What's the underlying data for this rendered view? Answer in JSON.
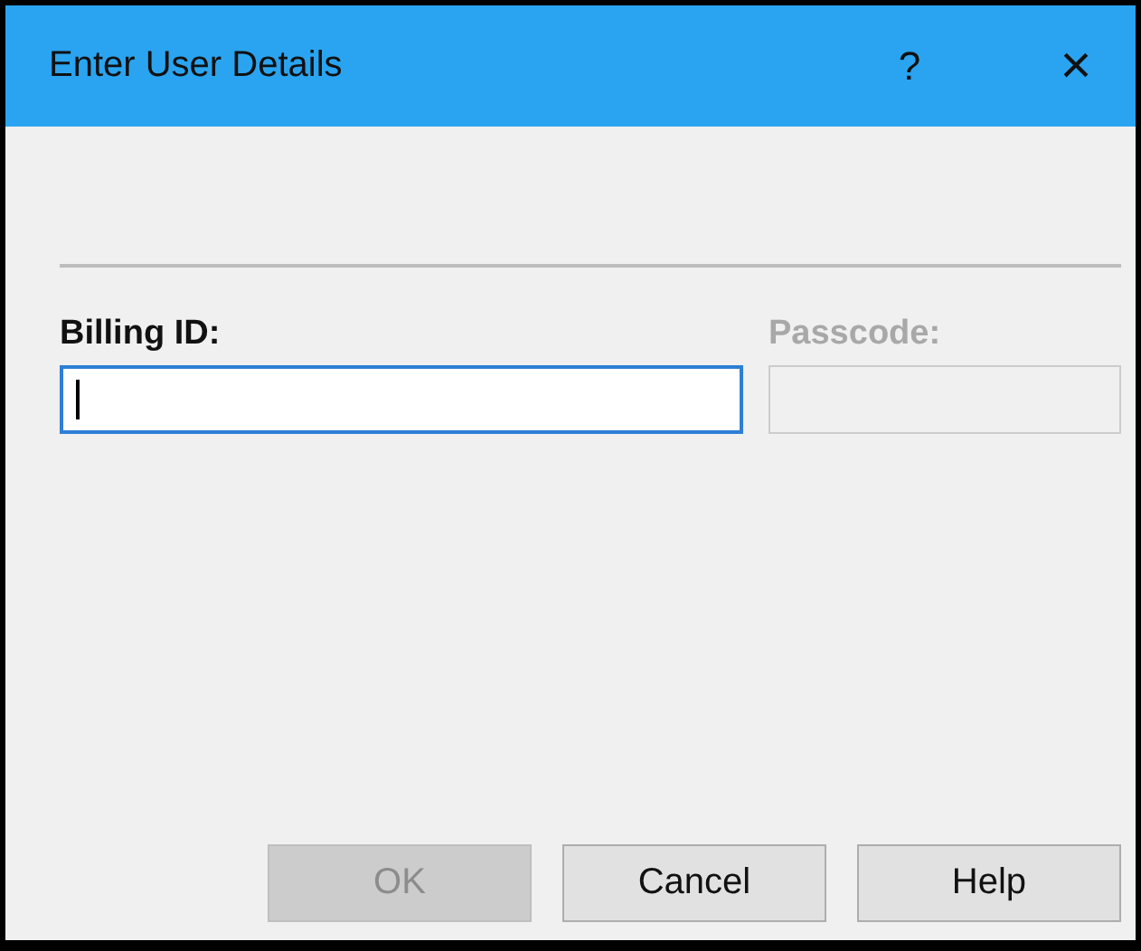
{
  "window": {
    "title": "Enter User Details",
    "help_button": "?",
    "close_button": "×"
  },
  "fields": [
    {
      "label": "Billing ID:",
      "disabled": false,
      "focused": true
    },
    {
      "label": "Passcode:",
      "disabled": true,
      "focused": false
    }
  ],
  "buttons": [
    {
      "label": "OK",
      "disabled": true
    },
    {
      "label": "Cancel",
      "disabled": false
    },
    {
      "label": "Help",
      "disabled": false
    }
  ]
}
